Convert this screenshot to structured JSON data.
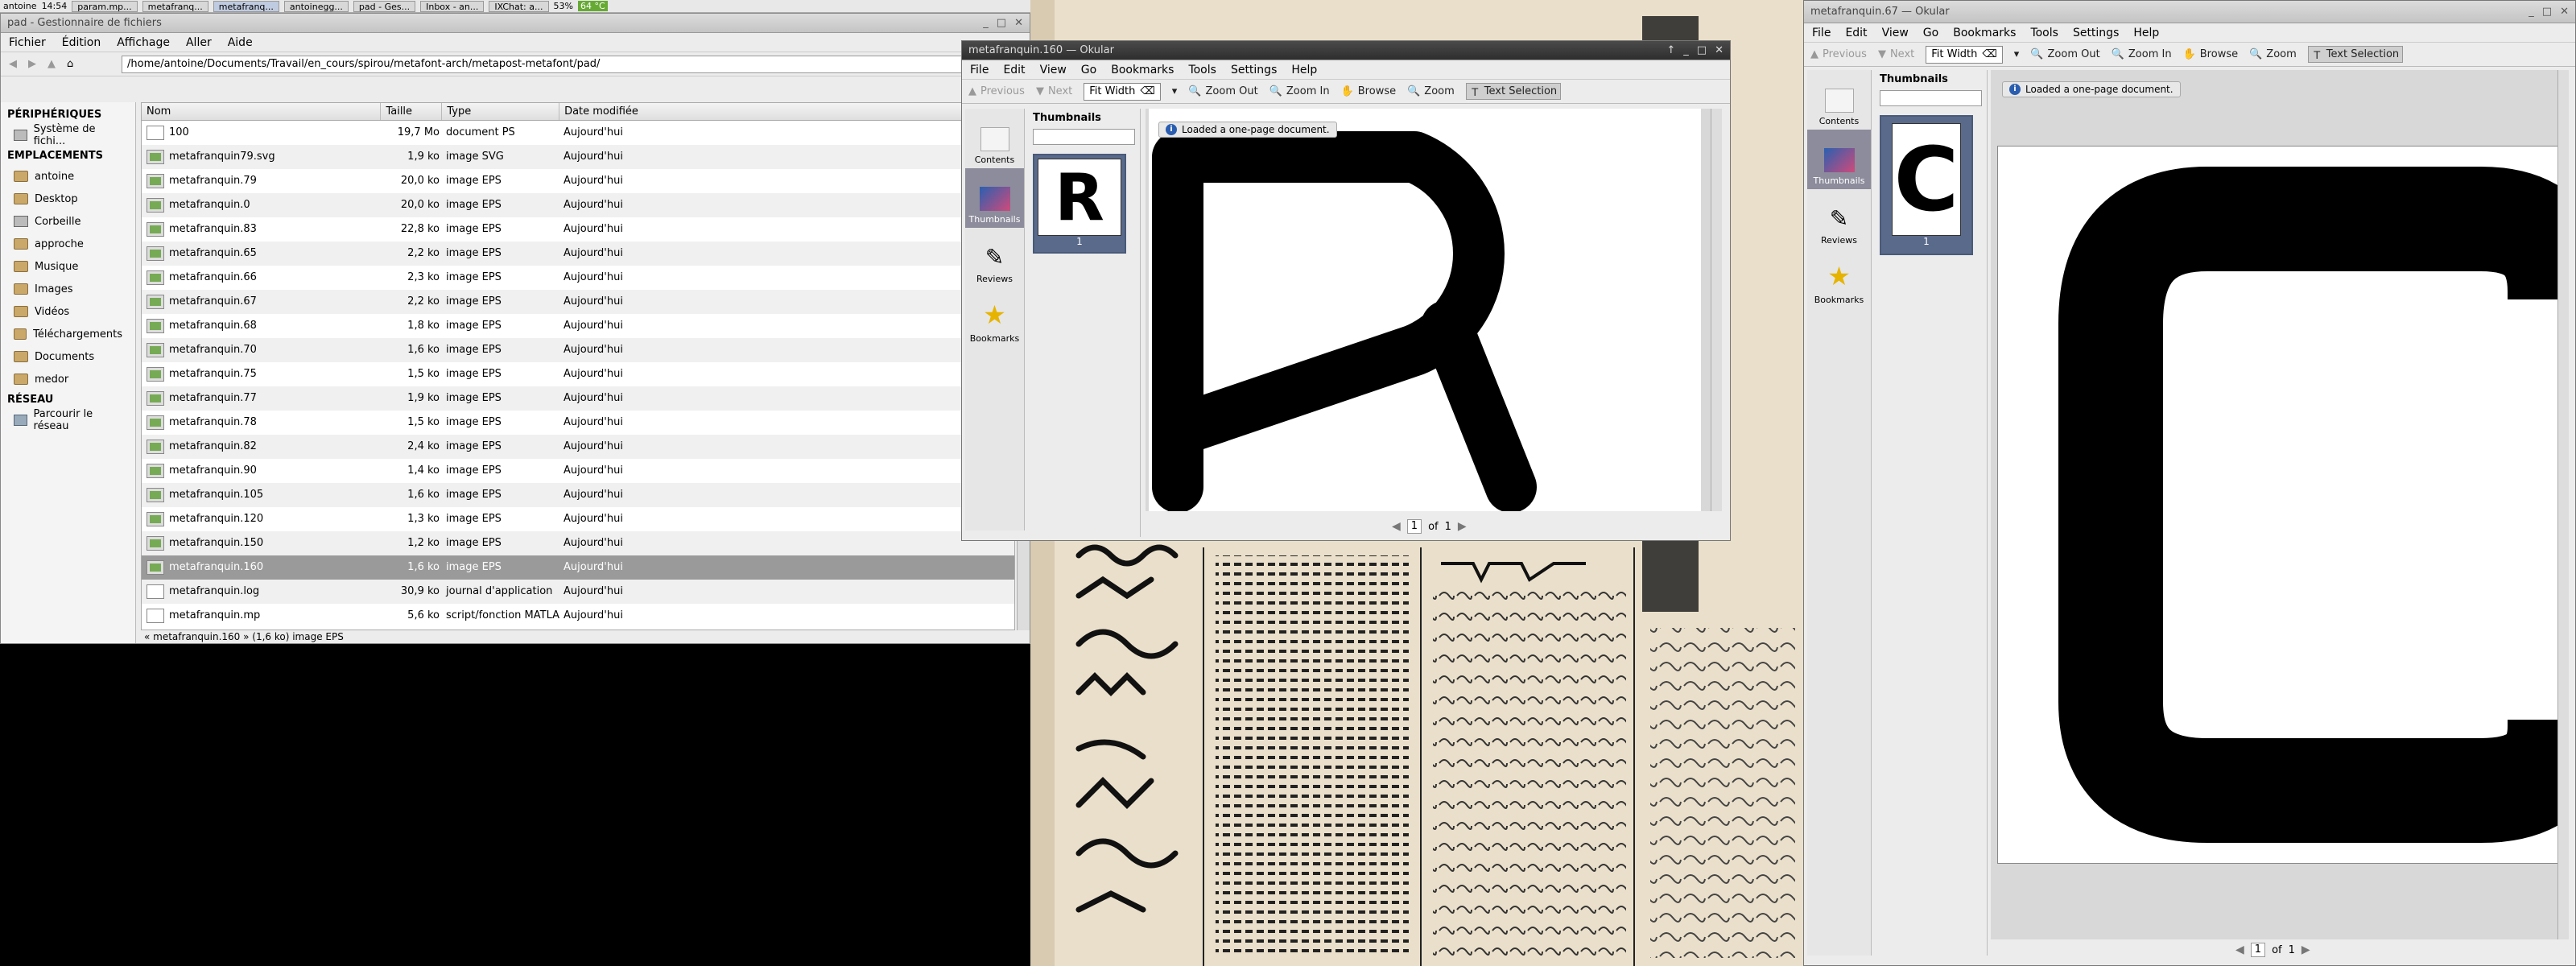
{
  "taskbar": {
    "user": "antoine",
    "time": "14:54",
    "tasks": [
      "param.mp...",
      "metafranq...",
      "metafranq...",
      "antoinegg...",
      "pad - Ges...",
      "Inbox - an...",
      "IXChat: a..."
    ],
    "battery": "53%",
    "temp": "64 °C"
  },
  "nautilus": {
    "title": "pad - Gestionnaire de fichiers",
    "menu": [
      "Fichier",
      "Édition",
      "Affichage",
      "Aller",
      "Aide"
    ],
    "path": "/home/antoine/Documents/Travail/en_cours/spirou/metafont-arch/metapost-metafont/pad/",
    "sidebar": {
      "devices_head": "PÉRIPHÉRIQUES",
      "devices": [
        "Système de fichi..."
      ],
      "places_head": "EMPLACEMENTS",
      "places": [
        "antoine",
        "Desktop",
        "Corbeille",
        "approche",
        "Musique",
        "Images",
        "Vidéos",
        "Téléchargements",
        "Documents",
        "medor"
      ],
      "network_head": "RÉSEAU",
      "network": [
        "Parcourir le réseau"
      ]
    },
    "columns": [
      "Nom",
      "Taille",
      "Type",
      "Date modifiée"
    ],
    "rows": [
      {
        "name": "100",
        "size": "19,7 Mo",
        "type": "document PS",
        "date": "Aujourd'hui",
        "icon": "txt"
      },
      {
        "name": "metafranquin79.svg",
        "size": "1,9 ko",
        "type": "image SVG",
        "date": "Aujourd'hui",
        "icon": "eps"
      },
      {
        "name": "metafranquin.79",
        "size": "20,0 ko",
        "type": "image EPS",
        "date": "Aujourd'hui",
        "icon": "eps"
      },
      {
        "name": "metafranquin.0",
        "size": "20,0 ko",
        "type": "image EPS",
        "date": "Aujourd'hui",
        "icon": "eps"
      },
      {
        "name": "metafranquin.83",
        "size": "22,8 ko",
        "type": "image EPS",
        "date": "Aujourd'hui",
        "icon": "eps"
      },
      {
        "name": "metafranquin.65",
        "size": "2,2 ko",
        "type": "image EPS",
        "date": "Aujourd'hui",
        "icon": "eps"
      },
      {
        "name": "metafranquin.66",
        "size": "2,3 ko",
        "type": "image EPS",
        "date": "Aujourd'hui",
        "icon": "eps"
      },
      {
        "name": "metafranquin.67",
        "size": "2,2 ko",
        "type": "image EPS",
        "date": "Aujourd'hui",
        "icon": "eps"
      },
      {
        "name": "metafranquin.68",
        "size": "1,8 ko",
        "type": "image EPS",
        "date": "Aujourd'hui",
        "icon": "eps"
      },
      {
        "name": "metafranquin.70",
        "size": "1,6 ko",
        "type": "image EPS",
        "date": "Aujourd'hui",
        "icon": "eps"
      },
      {
        "name": "metafranquin.75",
        "size": "1,5 ko",
        "type": "image EPS",
        "date": "Aujourd'hui",
        "icon": "eps"
      },
      {
        "name": "metafranquin.77",
        "size": "1,9 ko",
        "type": "image EPS",
        "date": "Aujourd'hui",
        "icon": "eps"
      },
      {
        "name": "metafranquin.78",
        "size": "1,5 ko",
        "type": "image EPS",
        "date": "Aujourd'hui",
        "icon": "eps"
      },
      {
        "name": "metafranquin.82",
        "size": "2,4 ko",
        "type": "image EPS",
        "date": "Aujourd'hui",
        "icon": "eps"
      },
      {
        "name": "metafranquin.90",
        "size": "1,4 ko",
        "type": "image EPS",
        "date": "Aujourd'hui",
        "icon": "eps"
      },
      {
        "name": "metafranquin.105",
        "size": "1,6 ko",
        "type": "image EPS",
        "date": "Aujourd'hui",
        "icon": "eps"
      },
      {
        "name": "metafranquin.120",
        "size": "1,3 ko",
        "type": "image EPS",
        "date": "Aujourd'hui",
        "icon": "eps"
      },
      {
        "name": "metafranquin.150",
        "size": "1,2 ko",
        "type": "image EPS",
        "date": "Aujourd'hui",
        "icon": "eps"
      },
      {
        "name": "metafranquin.160",
        "size": "1,6 ko",
        "type": "image EPS",
        "date": "Aujourd'hui",
        "icon": "eps",
        "selected": true
      },
      {
        "name": "metafranquin.log",
        "size": "30,9 ko",
        "type": "journal d'application",
        "date": "Aujourd'hui",
        "icon": "txt"
      },
      {
        "name": "metafranquin.mp",
        "size": "5,6 ko",
        "type": "script/fonction MATLAB",
        "date": "Aujourd'hui",
        "icon": "txt"
      }
    ],
    "status": "« metafranquin.160 » (1,6 ko) image EPS"
  },
  "okular1": {
    "title": "metafranquin.160 — Okular",
    "menu": [
      "File",
      "Edit",
      "View",
      "Go",
      "Bookmarks",
      "Tools",
      "Settings",
      "Help"
    ],
    "toolbar": {
      "previous": "Previous",
      "next": "Next",
      "zoom_mode": "Fit Width",
      "zoom_out": "Zoom Out",
      "zoom_in": "Zoom In",
      "browse": "Browse",
      "zoom": "Zoom",
      "text_selection": "Text Selection"
    },
    "side_tabs": [
      "Contents",
      "Thumbnails",
      "Reviews",
      "Bookmarks"
    ],
    "thumbs_label": "Thumbnails",
    "thumb_page": "1",
    "thumb_glyph": "R",
    "notice": "Loaded a one-page document.",
    "page_current": "1",
    "page_of": "of",
    "page_total": "1"
  },
  "okular2": {
    "title": "metafranquin.67 — Okular",
    "menu": [
      "File",
      "Edit",
      "View",
      "Go",
      "Bookmarks",
      "Tools",
      "Settings",
      "Help"
    ],
    "toolbar": {
      "previous": "Previous",
      "next": "Next",
      "zoom_mode": "Fit Width",
      "zoom_out": "Zoom Out",
      "zoom_in": "Zoom In",
      "browse": "Browse",
      "zoom": "Zoom",
      "text_selection": "Text Selection"
    },
    "side_tabs": [
      "Contents",
      "Thumbnails",
      "Reviews",
      "Bookmarks"
    ],
    "thumbs_label": "Thumbnails",
    "thumb_page": "1",
    "thumb_glyph": "C",
    "notice": "Loaded a one-page document.",
    "page_current": "1",
    "page_of": "of",
    "page_total": "1"
  }
}
